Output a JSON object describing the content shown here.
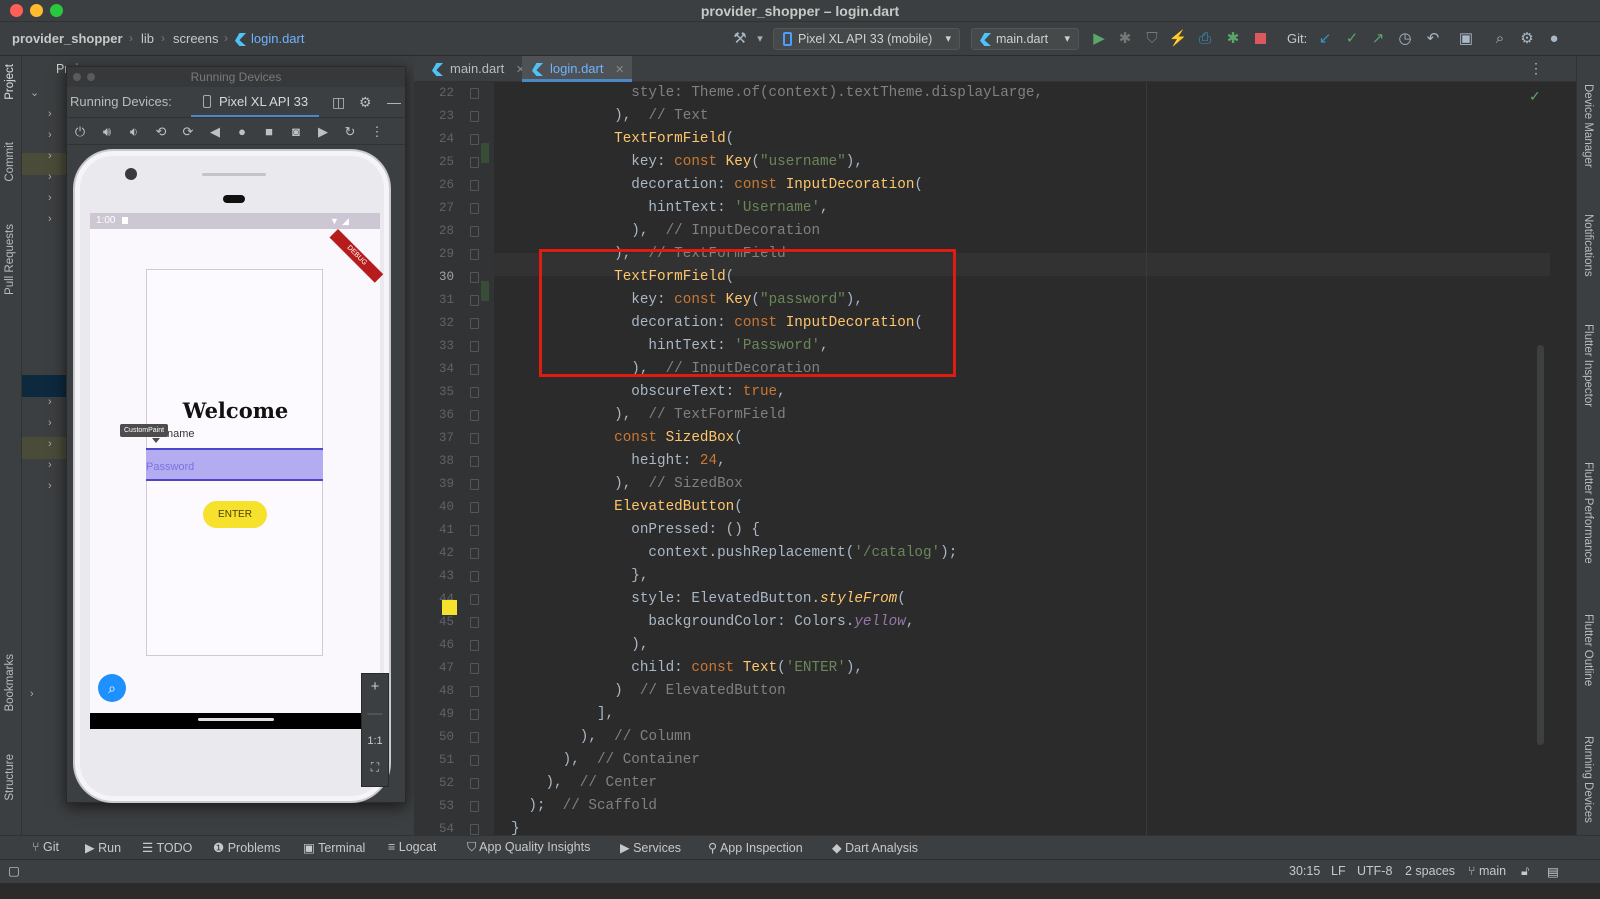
{
  "window": {
    "title": "provider_shopper – login.dart"
  },
  "breadcrumb": [
    "provider_shopper",
    "lib",
    "screens",
    "login.dart"
  ],
  "toolbar": {
    "device": "Pixel XL API 33 (mobile)",
    "run_config": "main.dart",
    "git_label": "Git:"
  },
  "left_tools": [
    "Project",
    "Commit",
    "Pull Requests",
    "Bookmarks",
    "Structure"
  ],
  "right_tools": [
    "Device Manager",
    "Notifications",
    "Flutter Inspector",
    "Flutter Performance",
    "Flutter Outline",
    "Running Devices"
  ],
  "project_panel": {
    "title": "Proje"
  },
  "running_devices": {
    "window_title": "Running Devices",
    "label": "Running Devices:",
    "device_tab": "Pixel XL API 33"
  },
  "phone": {
    "time": "1:00",
    "debug_banner": "DEBUG",
    "welcome": "Welcome",
    "username_partial": "name",
    "password_hint": "Password",
    "enter_label": "ENTER",
    "tooltip": "CustomPaint",
    "zoom_ratio": "1:1"
  },
  "editor": {
    "tabs": [
      {
        "label": "main.dart",
        "active": false
      },
      {
        "label": "login.dart",
        "active": true
      }
    ],
    "first_line": 22,
    "current_line": 30
  },
  "code_lines": [
    [
      [
        "                style: Theme.of(context).textTheme.displayLarge,",
        "c"
      ]
    ],
    [
      [
        "              ),  ",
        ""
      ],
      [
        "// Text",
        "c"
      ]
    ],
    [
      [
        "              ",
        ""
      ],
      [
        "TextFormField",
        "cls"
      ],
      [
        "(",
        ""
      ]
    ],
    [
      [
        "                key: ",
        ""
      ],
      [
        "const ",
        "k"
      ],
      [
        "Key",
        "cls"
      ],
      [
        "(",
        ""
      ],
      [
        "\"username\"",
        "s"
      ],
      [
        "),",
        ""
      ]
    ],
    [
      [
        "                decoration: ",
        ""
      ],
      [
        "const ",
        "k"
      ],
      [
        "InputDecoration",
        "cls"
      ],
      [
        "(",
        ""
      ]
    ],
    [
      [
        "                  hintText: ",
        ""
      ],
      [
        "'Username'",
        "s"
      ],
      [
        ",",
        ""
      ]
    ],
    [
      [
        "                ),  ",
        ""
      ],
      [
        "// InputDecoration",
        "c"
      ]
    ],
    [
      [
        "              ),  ",
        ""
      ],
      [
        "// TextFormField",
        "c"
      ]
    ],
    [
      [
        "              ",
        ""
      ],
      [
        "TextFormField",
        "cls"
      ],
      [
        "(",
        ""
      ]
    ],
    [
      [
        "                key: ",
        ""
      ],
      [
        "const ",
        "k"
      ],
      [
        "Key",
        "cls"
      ],
      [
        "(",
        ""
      ],
      [
        "\"password\"",
        "s"
      ],
      [
        "),",
        ""
      ]
    ],
    [
      [
        "                decoration: ",
        ""
      ],
      [
        "const ",
        "k"
      ],
      [
        "InputDecoration",
        "cls"
      ],
      [
        "(",
        ""
      ]
    ],
    [
      [
        "                  hintText: ",
        ""
      ],
      [
        "'Password'",
        "s"
      ],
      [
        ",",
        ""
      ]
    ],
    [
      [
        "                ),  ",
        ""
      ],
      [
        "// InputDecoration",
        "c"
      ]
    ],
    [
      [
        "                obscureText: ",
        ""
      ],
      [
        "true",
        "k"
      ],
      [
        ",",
        ""
      ]
    ],
    [
      [
        "              ),  ",
        ""
      ],
      [
        "// TextFormField",
        "c"
      ]
    ],
    [
      [
        "              ",
        ""
      ],
      [
        "const ",
        "k"
      ],
      [
        "SizedBox",
        "cls"
      ],
      [
        "(",
        ""
      ]
    ],
    [
      [
        "                height: ",
        ""
      ],
      [
        "24",
        "k"
      ],
      [
        ",",
        ""
      ]
    ],
    [
      [
        "              ),  ",
        ""
      ],
      [
        "// SizedBox",
        "c"
      ]
    ],
    [
      [
        "              ",
        ""
      ],
      [
        "ElevatedButton",
        "cls"
      ],
      [
        "(",
        ""
      ]
    ],
    [
      [
        "                onPressed: () {",
        ""
      ]
    ],
    [
      [
        "                  context.pushReplacement(",
        ""
      ],
      [
        "'/catalog'",
        "s"
      ],
      [
        ");",
        ""
      ]
    ],
    [
      [
        "                },",
        ""
      ]
    ],
    [
      [
        "                style: ElevatedButton.",
        ""
      ],
      [
        "styleFrom",
        "m"
      ],
      [
        "(",
        ""
      ]
    ],
    [
      [
        "                  backgroundColor: Colors.",
        ""
      ],
      [
        "yellow",
        "i"
      ],
      [
        ",",
        ""
      ]
    ],
    [
      [
        "                ),",
        ""
      ]
    ],
    [
      [
        "                child: ",
        ""
      ],
      [
        "const ",
        "k"
      ],
      [
        "Text",
        "cls"
      ],
      [
        "(",
        ""
      ],
      [
        "'ENTER'",
        "s"
      ],
      [
        "),",
        ""
      ]
    ],
    [
      [
        "              )  ",
        ""
      ],
      [
        "// ElevatedButton",
        "c"
      ]
    ],
    [
      [
        "            ],",
        ""
      ]
    ],
    [
      [
        "          ),  ",
        ""
      ],
      [
        "// Column",
        "c"
      ]
    ],
    [
      [
        "        ),  ",
        ""
      ],
      [
        "// Container",
        "c"
      ]
    ],
    [
      [
        "      ),  ",
        ""
      ],
      [
        "// Center",
        "c"
      ]
    ],
    [
      [
        "    );  ",
        ""
      ],
      [
        "// Scaffold",
        "c"
      ]
    ],
    [
      [
        "  }",
        ""
      ]
    ],
    [
      [
        "}",
        ""
      ]
    ]
  ],
  "bottom_tools": [
    "Git",
    "Run",
    "TODO",
    "Problems",
    "Terminal",
    "Logcat",
    "App Quality Insights",
    "Services",
    "App Inspection",
    "Dart Analysis"
  ],
  "status": {
    "position": "30:15",
    "line_sep": "LF",
    "encoding": "UTF-8",
    "indent": "2 spaces",
    "branch": "main"
  },
  "colors": {
    "highlight_box": "#e01b10",
    "accent": "#4a88c7",
    "button_yellow": "#f6e12d"
  }
}
